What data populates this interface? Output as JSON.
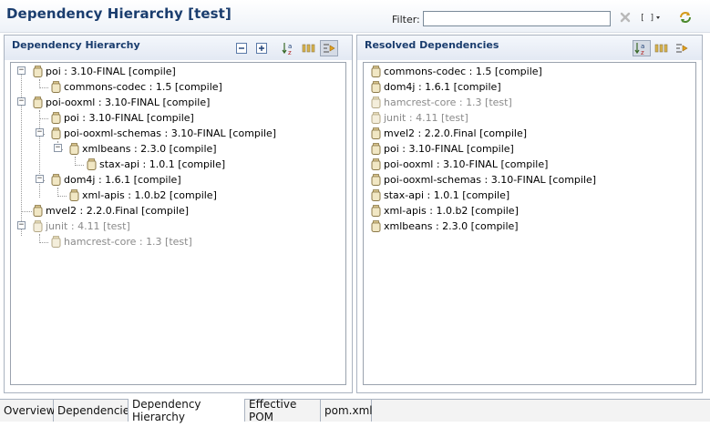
{
  "header": {
    "title": "Dependency Hierarchy [test]",
    "filter_label": "Filter:",
    "filter_value": ""
  },
  "left_panel": {
    "title": "Dependency Hierarchy",
    "items": [
      {
        "label": "poi : 3.10-FINAL [compile]",
        "depth": 0,
        "toggle": "minus",
        "scope": "compile"
      },
      {
        "label": "commons-codec : 1.5 [compile]",
        "depth": 1,
        "toggle": "",
        "scope": "compile"
      },
      {
        "label": "poi-ooxml : 3.10-FINAL [compile]",
        "depth": 0,
        "toggle": "minus",
        "scope": "compile"
      },
      {
        "label": "poi : 3.10-FINAL [compile]",
        "depth": 1,
        "toggle": "",
        "scope": "compile"
      },
      {
        "label": "poi-ooxml-schemas : 3.10-FINAL [compile]",
        "depth": 1,
        "toggle": "minus",
        "scope": "compile"
      },
      {
        "label": "xmlbeans : 2.3.0 [compile]",
        "depth": 2,
        "toggle": "minus",
        "scope": "compile"
      },
      {
        "label": "stax-api : 1.0.1 [compile]",
        "depth": 3,
        "toggle": "",
        "scope": "compile"
      },
      {
        "label": "dom4j : 1.6.1 [compile]",
        "depth": 1,
        "toggle": "minus",
        "scope": "compile"
      },
      {
        "label": "xml-apis : 1.0.b2 [compile]",
        "depth": 2,
        "toggle": "",
        "scope": "compile"
      },
      {
        "label": "mvel2 : 2.2.0.Final [compile]",
        "depth": 0,
        "toggle": "",
        "scope": "compile"
      },
      {
        "label": "junit : 4.11 [test]",
        "depth": 0,
        "toggle": "minus",
        "scope": "test"
      },
      {
        "label": "hamcrest-core : 1.3 [test]",
        "depth": 1,
        "toggle": "",
        "scope": "test"
      }
    ]
  },
  "right_panel": {
    "title": "Resolved Dependencies",
    "items": [
      {
        "label": "commons-codec : 1.5 [compile]",
        "scope": "compile"
      },
      {
        "label": "dom4j : 1.6.1 [compile]",
        "scope": "compile"
      },
      {
        "label": "hamcrest-core : 1.3 [test]",
        "scope": "test"
      },
      {
        "label": "junit : 4.11 [test]",
        "scope": "test"
      },
      {
        "label": "mvel2 : 2.2.0.Final [compile]",
        "scope": "compile"
      },
      {
        "label": "poi : 3.10-FINAL [compile]",
        "scope": "compile"
      },
      {
        "label": "poi-ooxml : 3.10-FINAL [compile]",
        "scope": "compile"
      },
      {
        "label": "poi-ooxml-schemas : 3.10-FINAL [compile]",
        "scope": "compile"
      },
      {
        "label": "stax-api : 1.0.1 [compile]",
        "scope": "compile"
      },
      {
        "label": "xml-apis : 1.0.b2 [compile]",
        "scope": "compile"
      },
      {
        "label": "xmlbeans : 2.3.0 [compile]",
        "scope": "compile"
      }
    ]
  },
  "tabs": [
    {
      "label": "Overview",
      "active": false
    },
    {
      "label": "Dependencies",
      "active": false
    },
    {
      "label": "Dependency Hierarchy",
      "active": true
    },
    {
      "label": "Effective POM",
      "active": false
    },
    {
      "label": "pom.xml",
      "active": false
    }
  ],
  "icons": {
    "collapse_all": "collapse-all-icon",
    "expand_all": "expand-all-icon",
    "sort": "sort-alpha-icon",
    "show_groupid": "show-groupid-icon",
    "link_selection": "link-selection-icon",
    "clear_filter": "clear-filter-icon",
    "view_menu": "view-menu-icon",
    "refresh": "refresh-icon"
  },
  "colors": {
    "title": "#1a3d6e",
    "test_scope_text": "#8a8a8a",
    "jar_fill": "#f1e7c4",
    "jar_stroke": "#8c7a4a"
  }
}
